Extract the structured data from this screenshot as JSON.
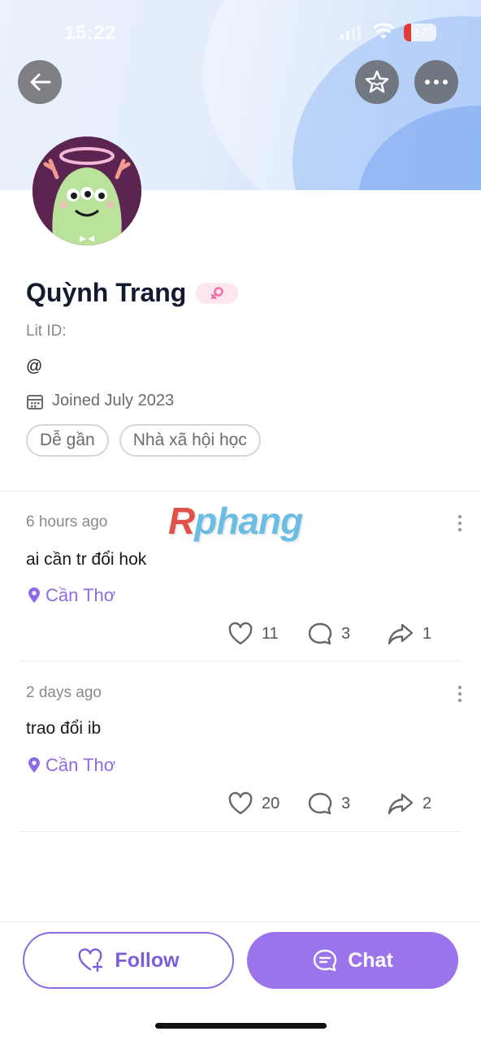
{
  "status": {
    "time": "15:22",
    "battery": "17"
  },
  "header": {
    "icons": [
      "back-arrow-icon",
      "star-icon",
      "more-icon"
    ]
  },
  "profile": {
    "name": "Quỳnh Trang",
    "lit_id_label": "Lit ID:",
    "handle": "@",
    "joined": "Joined July 2023",
    "tags": [
      "Dễ gần",
      "Nhà xã hội học"
    ]
  },
  "watermark": {
    "r": "R",
    "rest": "phang"
  },
  "posts": [
    {
      "ago": "6 hours ago",
      "text": "ai cần tr đổi hok",
      "location": "Cần Thơ",
      "likes": "11",
      "comments": "3",
      "shares": "1"
    },
    {
      "ago": "2 days ago",
      "text": "trao đổi ib",
      "location": "Cần Thơ",
      "likes": "20",
      "comments": "3",
      "shares": "2"
    }
  ],
  "actions": {
    "follow": "Follow",
    "chat": "Chat"
  },
  "colors": {
    "accent": "#9b74ec",
    "location": "#8f6ae6",
    "follow_border": "#8a6ae2"
  }
}
